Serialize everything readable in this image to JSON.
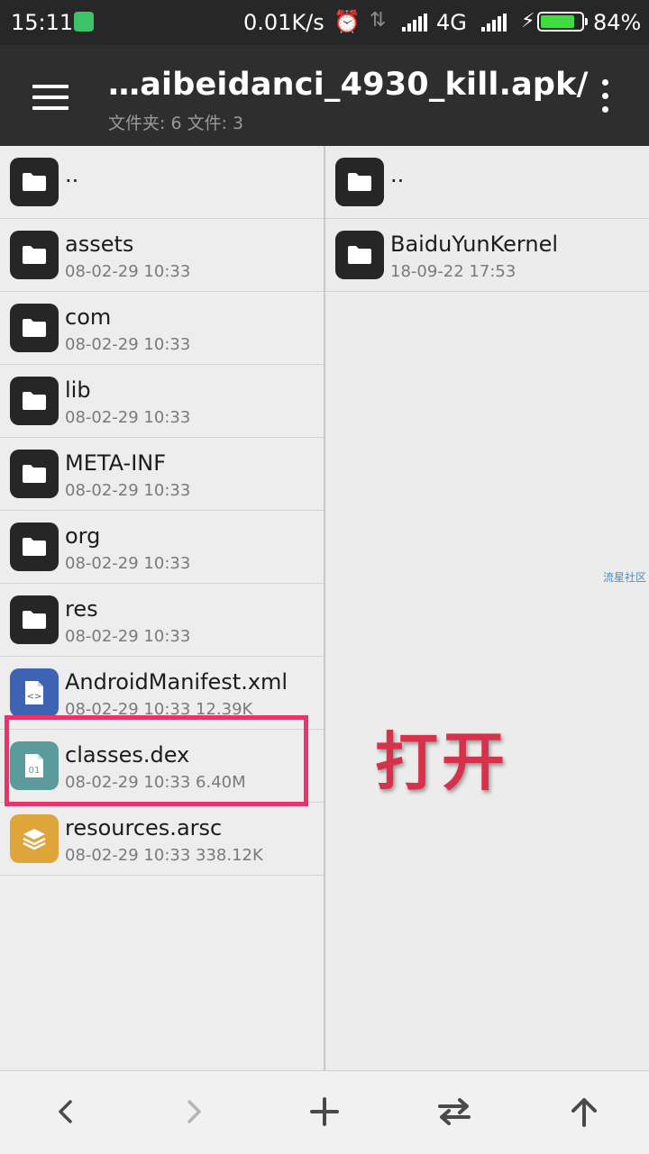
{
  "status_bar": {
    "time": "15:11",
    "speed": "0.01K/s",
    "network": "4G",
    "battery": "84%",
    "battery_level": 0.84
  },
  "app_bar": {
    "title": "…aibeidanci_4930_kill.apk/",
    "subtitle": "文件夹: 6  文件: 3"
  },
  "left_pane": {
    "items": [
      {
        "name": "..",
        "meta": "",
        "icon": "folder-icon"
      },
      {
        "name": "assets",
        "meta": "08-02-29 10:33",
        "icon": "folder-icon"
      },
      {
        "name": "com",
        "meta": "08-02-29 10:33",
        "icon": "folder-icon"
      },
      {
        "name": "lib",
        "meta": "08-02-29 10:33",
        "icon": "folder-icon"
      },
      {
        "name": "META-INF",
        "meta": "08-02-29 10:33",
        "icon": "folder-icon"
      },
      {
        "name": "org",
        "meta": "08-02-29 10:33",
        "icon": "folder-icon"
      },
      {
        "name": "res",
        "meta": "08-02-29 10:33",
        "icon": "folder-icon"
      },
      {
        "name": "AndroidManifest.xml",
        "meta": "08-02-29 10:33  12.39K",
        "icon": "xml-file-icon"
      },
      {
        "name": "classes.dex",
        "meta": "08-02-29 10:33  6.40M",
        "icon": "dex-file-icon"
      },
      {
        "name": "resources.arsc",
        "meta": "08-02-29 10:33  338.12K",
        "icon": "arsc-file-icon"
      }
    ]
  },
  "right_pane": {
    "items": [
      {
        "name": "..",
        "meta": "",
        "icon": "folder-icon"
      },
      {
        "name": "BaiduYunKernel",
        "meta": "18-09-22 17:53",
        "icon": "folder-icon"
      }
    ],
    "watermark": "流星社区"
  },
  "annotation": {
    "text": "打开",
    "color": "#d7324b",
    "highlight_color": "#f0306a"
  },
  "toolbar": {
    "buttons": [
      "back-icon",
      "forward-icon",
      "add-icon",
      "swap-icon",
      "up-icon"
    ]
  }
}
